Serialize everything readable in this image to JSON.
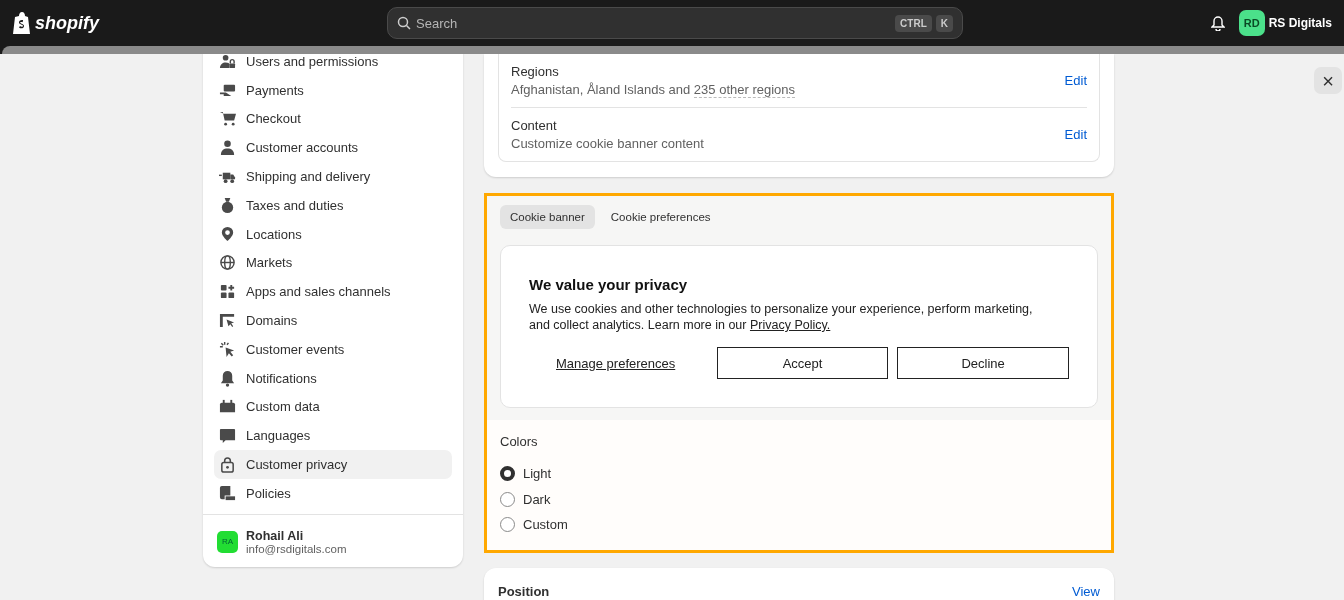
{
  "topbar": {
    "logo": "shopify",
    "search": {
      "placeholder": "Search",
      "shortcut_keys": [
        "CTRL",
        "K"
      ]
    },
    "store": {
      "initials": "RD",
      "name": "RS Digitals"
    }
  },
  "sidebar": {
    "items": [
      {
        "label": "Users and permissions",
        "selected": false
      },
      {
        "label": "Payments",
        "selected": false
      },
      {
        "label": "Checkout",
        "selected": false
      },
      {
        "label": "Customer accounts",
        "selected": false
      },
      {
        "label": "Shipping and delivery",
        "selected": false
      },
      {
        "label": "Taxes and duties",
        "selected": false
      },
      {
        "label": "Locations",
        "selected": false
      },
      {
        "label": "Markets",
        "selected": false
      },
      {
        "label": "Apps and sales channels",
        "selected": false
      },
      {
        "label": "Domains",
        "selected": false
      },
      {
        "label": "Customer events",
        "selected": false
      },
      {
        "label": "Notifications",
        "selected": false
      },
      {
        "label": "Custom data",
        "selected": false
      },
      {
        "label": "Languages",
        "selected": false
      },
      {
        "label": "Customer privacy",
        "selected": true
      },
      {
        "label": "Policies",
        "selected": false
      }
    ],
    "user": {
      "initials": "RA",
      "name": "Rohail Ali",
      "email": "info@rsdigitals.com"
    }
  },
  "settings_rows": [
    {
      "title": "Regions",
      "value_prefix": "Afghanistan, Åland Islands and ",
      "value_link": "235 other regions",
      "action": "Edit"
    },
    {
      "title": "Content",
      "value_prefix": "Customize cookie banner content",
      "action": "Edit"
    }
  ],
  "preview": {
    "tabs": [
      {
        "label": "Cookie banner",
        "selected": true
      },
      {
        "label": "Cookie preferences",
        "selected": false
      }
    ],
    "banner": {
      "title": "We value your privacy",
      "body": "We use cookies and other technologies to personalize your experience, perform marketing, and collect analytics. Learn more in our ",
      "link": "Privacy Policy.",
      "manage": "Manage preferences",
      "buttons": [
        "Accept",
        "Decline"
      ]
    }
  },
  "colors": {
    "label": "Colors",
    "options": [
      {
        "label": "Light",
        "selected": true
      },
      {
        "label": "Dark",
        "selected": false
      },
      {
        "label": "Custom",
        "selected": false
      }
    ]
  },
  "position": {
    "title": "Position",
    "action": "View"
  },
  "close_button": "×"
}
